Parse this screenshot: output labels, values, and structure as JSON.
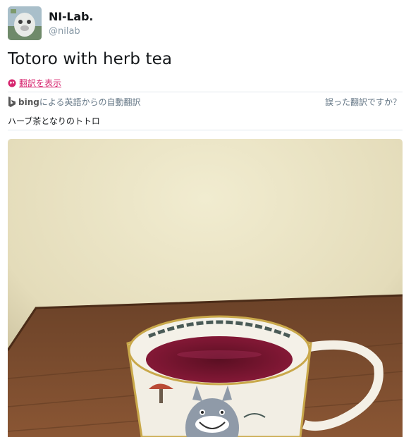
{
  "user": {
    "display_name": "NI-Lab.",
    "handle": "@nilab"
  },
  "tweet": {
    "text": "Totoro with herb tea"
  },
  "translation": {
    "show_link_label": "翻訳を表示",
    "provider_brand": "bing",
    "provider_suffix": "による英語からの自動翻訳",
    "report_label": "誤った翻訳ですか？",
    "translated_text": "ハーブ茶となりのトトロ"
  },
  "icons": {
    "globe": "globe-icon",
    "bing": "bing-logo-icon"
  },
  "colors": {
    "link": "#d6246e",
    "muted": "#657786",
    "divider": "#e1e8ed"
  }
}
